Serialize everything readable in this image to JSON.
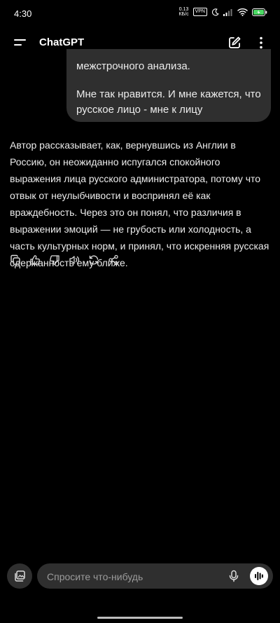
{
  "status_bar": {
    "time": "4:30",
    "net_speed_value": "0.13",
    "net_speed_unit": "КБ/с",
    "vpn": "VPN",
    "icons": [
      "moon-icon",
      "signal-icon",
      "wifi-icon",
      "battery-charging-icon"
    ]
  },
  "header": {
    "title": "ChatGPT",
    "icons": [
      "menu-icon",
      "new-chat-icon",
      "more-vertical-icon"
    ]
  },
  "conversation": {
    "user_message": {
      "line_partial": "межстрочного анализа.",
      "paragraph2": "Мне так нравится. И мне кажется, что русское лицо - мне к лицу"
    },
    "assistant_message": "Автор рассказывает, как, вернувшись из Англии в Россию, он неожиданно испугался спокойного выражения лица русского администратора, потому что отвык от неулыбчивости и воспринял её как враждебность. Через это он понял, что различия в выражении эмоций — не грубость или холодность, а часть культурных норм, и принял, что искренняя русская сдержанность ему ближе.",
    "action_icons": [
      "copy-icon",
      "thumbs-up-icon",
      "thumbs-down-icon",
      "read-aloud-icon",
      "regenerate-icon",
      "share-icon"
    ]
  },
  "composer": {
    "placeholder": "Спросите что-нибудь",
    "value": "",
    "icons": [
      "attach-icon",
      "microphone-icon",
      "voice-mode-icon"
    ]
  },
  "colors": {
    "background": "#000000",
    "bubble": "#2F2F2F",
    "text": "#ECECEC",
    "placeholder": "#9B9B9B",
    "battery": "#4CD964"
  }
}
